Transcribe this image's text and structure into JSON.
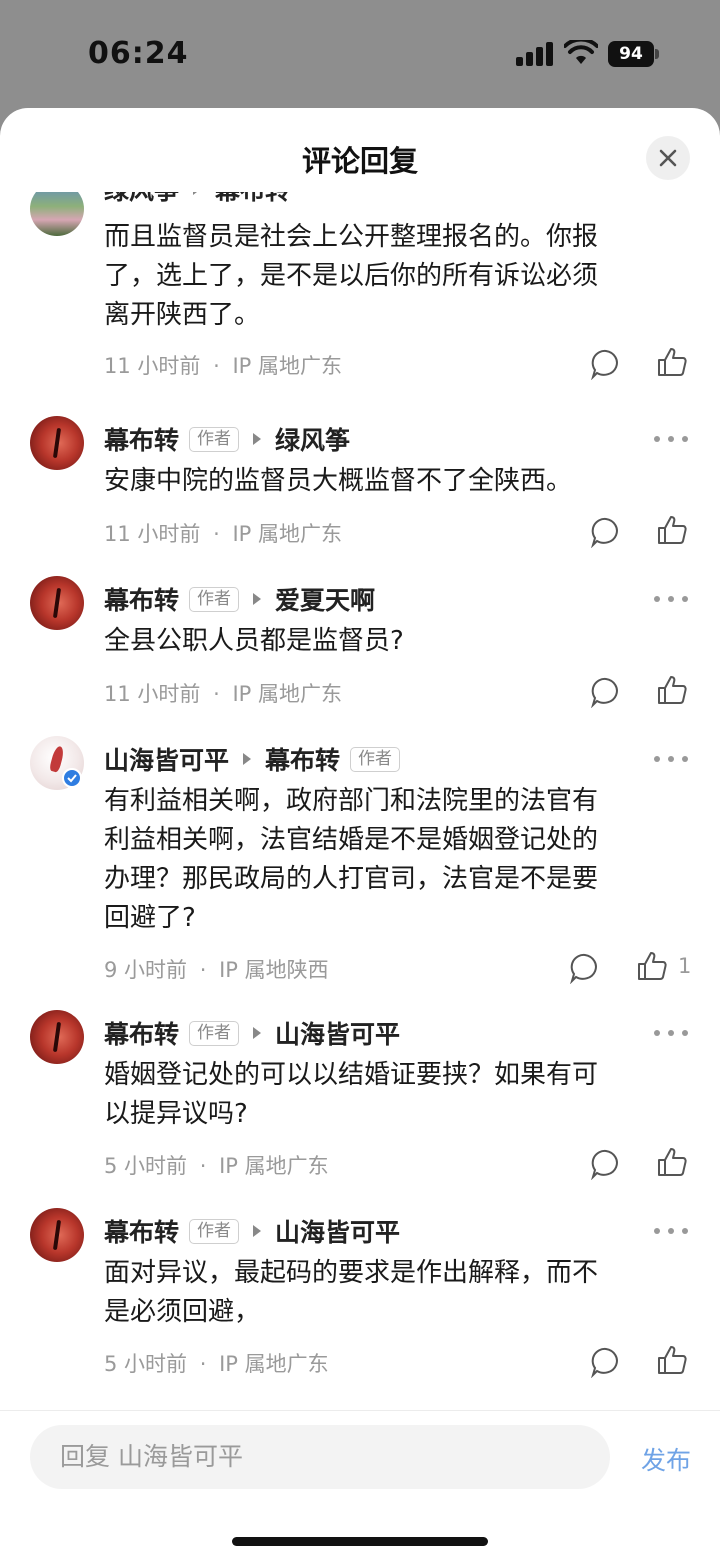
{
  "status": {
    "time": "06:24",
    "battery": "94"
  },
  "sheet": {
    "title": "评论回复"
  },
  "comments": [
    {
      "name": "绿风筝",
      "reply_to": "幕布转",
      "text": "而且监督员是社会上公开整理报名的。你报\n了，选上了，是不是以后你的所有诉讼必须\n离开陕西了。",
      "time": "11 小时前",
      "ip": "IP 属地广东",
      "likes": ""
    },
    {
      "name": "幕布转",
      "tag": "作者",
      "reply_to": "绿风筝",
      "text": "安康中院的监督员大概监督不了全陕西。",
      "time": "11 小时前",
      "ip": "IP 属地广东",
      "likes": ""
    },
    {
      "name": "幕布转",
      "tag": "作者",
      "reply_to": "爱夏天啊",
      "text": "全县公职人员都是监督员?",
      "time": "11 小时前",
      "ip": "IP 属地广东",
      "likes": ""
    },
    {
      "name": "山海皆可平",
      "reply_to": "幕布转",
      "reply_tag": "作者",
      "text": "有利益相关啊，政府部门和法院里的法官有\n利益相关啊，法官结婚是不是婚姻登记处的\n办理？那民政局的人打官司，法官是不是要\n回避了?",
      "time": "9 小时前",
      "ip": "IP 属地陕西",
      "likes": "1"
    },
    {
      "name": "幕布转",
      "tag": "作者",
      "reply_to": "山海皆可平",
      "text": "婚姻登记处的可以以结婚证要挟？如果有可\n以提异议吗?",
      "time": "5 小时前",
      "ip": "IP 属地广东",
      "likes": ""
    },
    {
      "name": "幕布转",
      "tag": "作者",
      "reply_to": "山海皆可平",
      "text": "面对异议，最起码的要求是作出解释，而不\n是必须回避，",
      "time": "5 小时前",
      "ip": "IP 属地广东",
      "likes": ""
    }
  ],
  "footer": {
    "separator": "·"
  },
  "input": {
    "placeholder": "回复 山海皆可平",
    "publish": "发布"
  },
  "colors": {
    "accent": "#6fa3e6",
    "verified": "#2f7de1"
  }
}
